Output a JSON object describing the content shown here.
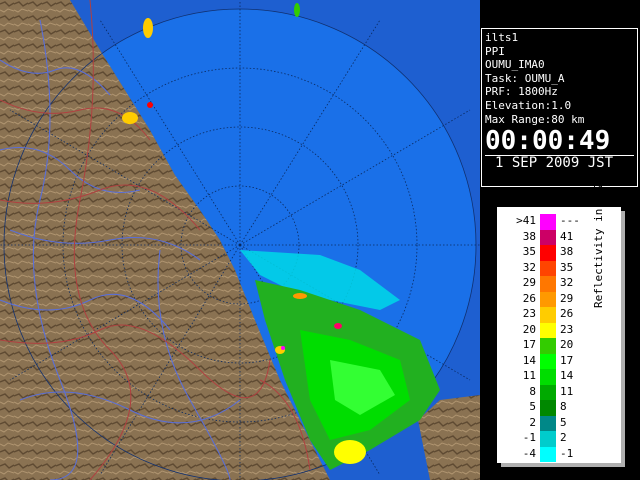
{
  "info": {
    "site": "ilts1",
    "scan": "PPI",
    "name": "OUMU_IMA0",
    "task": "Task: OUMU_A",
    "prf": "PRF: 1800Hz",
    "elevation": "Elevation:1.0",
    "max_range": "Max Range:80 km",
    "time": "00:00:49",
    "date": "1 SEP 2009 JST"
  },
  "legend": {
    "title": "Reflectivity in dBZ",
    "rows": [
      {
        "lo": ">41",
        "hi": "---",
        "color": "#ff00ff"
      },
      {
        "lo": "38",
        "hi": "41",
        "color": "#cc0066"
      },
      {
        "lo": "35",
        "hi": "38",
        "color": "#ff0000"
      },
      {
        "lo": "32",
        "hi": "35",
        "color": "#ff4400"
      },
      {
        "lo": "29",
        "hi": "32",
        "color": "#ff7700"
      },
      {
        "lo": "26",
        "hi": "29",
        "color": "#ff9900"
      },
      {
        "lo": "23",
        "hi": "26",
        "color": "#ffcc00"
      },
      {
        "lo": "20",
        "hi": "23",
        "color": "#ffff00"
      },
      {
        "lo": "17",
        "hi": "20",
        "color": "#33cc00"
      },
      {
        "lo": "14",
        "hi": "17",
        "color": "#00ff00"
      },
      {
        "lo": "11",
        "hi": "14",
        "color": "#00dd00"
      },
      {
        "lo": "8",
        "hi": "11",
        "color": "#00aa00"
      },
      {
        "lo": "5",
        "hi": "8",
        "color": "#008800"
      },
      {
        "lo": "2",
        "hi": "5",
        "color": "#008888"
      },
      {
        "lo": "-1",
        "hi": "2",
        "color": "#00cccc"
      },
      {
        "lo": "-4",
        "hi": "-1",
        "color": "#00ffff"
      }
    ]
  },
  "colors": {
    "sea": "#1a6fe0",
    "outer_ring": "#1e5fd0",
    "land": "#8a7050",
    "rivers": "#5a6fd8",
    "boundaries": "#b04040"
  }
}
